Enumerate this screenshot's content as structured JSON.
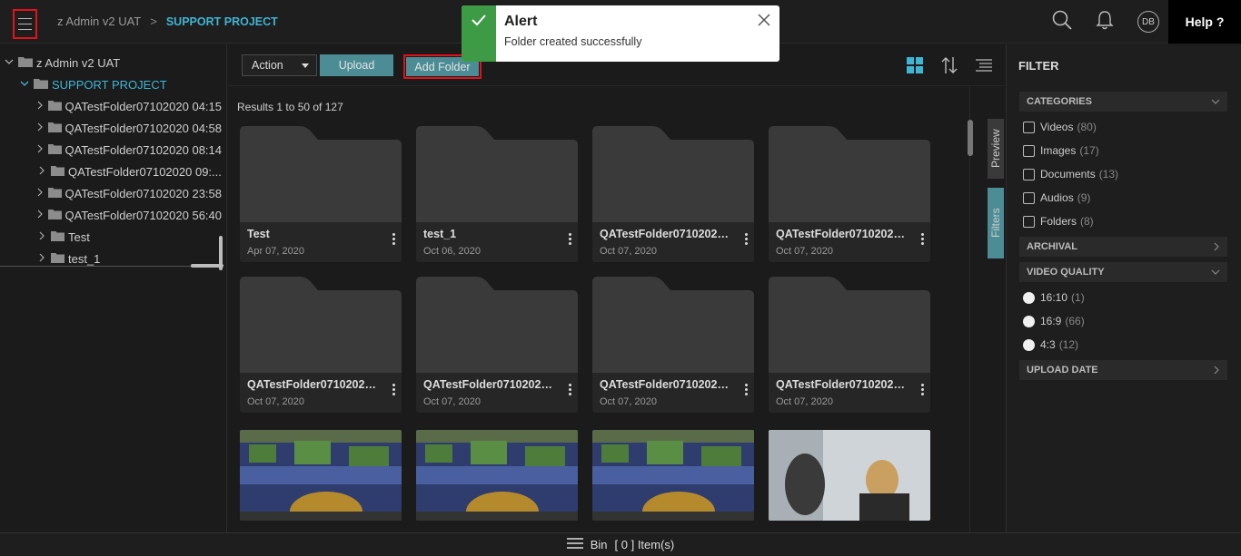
{
  "header": {
    "breadcrumb_root": "z Admin v2 UAT",
    "breadcrumb_sep": ">",
    "breadcrumb_current": "SUPPORT PROJECT",
    "avatar_initials": "DB",
    "help_label": "Help ?"
  },
  "alert": {
    "title": "Alert",
    "message": "Folder created successfully",
    "status_color": "#3d9b45"
  },
  "tree": {
    "root": "z Admin v2 UAT",
    "project": "SUPPORT PROJECT",
    "children": [
      "QATestFolder07102020 04:15",
      "QATestFolder07102020 04:58",
      "QATestFolder07102020 08:14",
      "QATestFolder07102020 09:...",
      "QATestFolder07102020 23:58",
      "QATestFolder07102020 56:40",
      "Test",
      "test_1"
    ]
  },
  "toolbar": {
    "action_label": "Action",
    "upload_label": "Upload",
    "add_folder_label": "Add Folder"
  },
  "results_text": "Results 1 to 50 of 127",
  "folders": [
    {
      "name": "Test",
      "date": "Apr 07, 2020"
    },
    {
      "name": "test_1",
      "date": "Oct 06, 2020"
    },
    {
      "name": "QATestFolder07102020 ...",
      "date": "Oct 07, 2020"
    },
    {
      "name": "QATestFolder07102020 ...",
      "date": "Oct 07, 2020"
    },
    {
      "name": "QATestFolder07102020 ...",
      "date": "Oct 07, 2020"
    },
    {
      "name": "QATestFolder07102020 ...",
      "date": "Oct 07, 2020"
    },
    {
      "name": "QATestFolder07102020 ...",
      "date": "Oct 07, 2020"
    },
    {
      "name": "QATestFolder07102020 ...",
      "date": "Oct 07, 2020"
    }
  ],
  "side_tabs": {
    "preview": "Preview",
    "filters": "Filters"
  },
  "filter": {
    "title": "FILTER",
    "categories_label": "CATEGORIES",
    "categories": [
      {
        "label": "Videos",
        "count": "(80)"
      },
      {
        "label": "Images",
        "count": "(17)"
      },
      {
        "label": "Documents",
        "count": "(13)"
      },
      {
        "label": "Audios",
        "count": "(9)"
      },
      {
        "label": "Folders",
        "count": "(8)"
      }
    ],
    "archival_label": "ARCHIVAL",
    "video_quality_label": "VIDEO QUALITY",
    "video_quality": [
      {
        "label": "16:10",
        "count": "(1)"
      },
      {
        "label": "16:9",
        "count": "(66)"
      },
      {
        "label": "4:3",
        "count": "(12)"
      }
    ],
    "upload_date_label": "UPLOAD DATE"
  },
  "bin": {
    "label": "Bin",
    "count_text": "[ 0 ] Item(s)"
  },
  "colors": {
    "accent": "#3fb5d4",
    "button": "#4b8c95",
    "highlight": "#e0131b"
  }
}
